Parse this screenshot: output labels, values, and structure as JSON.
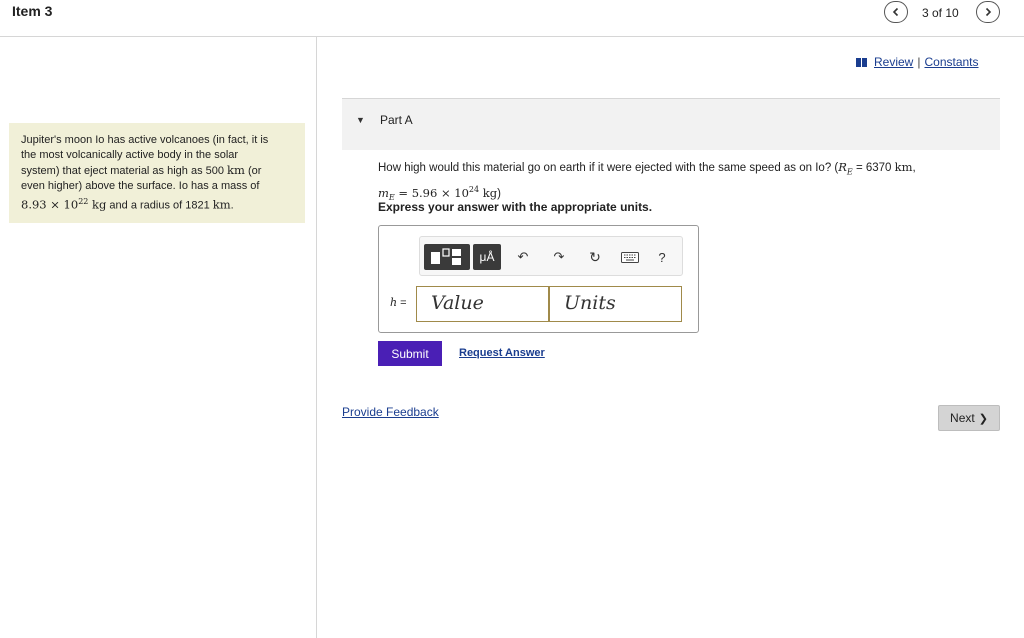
{
  "header": {
    "item_title": "Item 3",
    "pager": "3 of 10",
    "prev_icon": "chevron-left-icon",
    "next_icon": "chevron-right-icon"
  },
  "links": {
    "review": "Review",
    "separator": "|",
    "constants": "Constants",
    "book_icon": "book-icon"
  },
  "problem": {
    "line1": "Jupiter's moon Io has active volcanoes (in fact, it is",
    "line2": "the most volcanically active body in the solar",
    "line3a": "system) that eject material as high as 500 ",
    "line3b": "km",
    "line3c": " (or",
    "line4": "even higher) above the surface. Io has a mass of",
    "mass_base": "8.93 × 10",
    "mass_exp": "22",
    "mass_unit": " kg",
    "radius_text": " and a radius of 1821 ",
    "radius_unit": "km",
    "period": "."
  },
  "part": {
    "caret": "▼",
    "label": "Part A"
  },
  "question": {
    "text1": "How high would this material go on earth if it were ejected with the same speed as on Io? (",
    "re_symbol": "R",
    "re_sub": "E",
    "re_value": " = 6370 ",
    "re_unit": "km",
    "comma": ",",
    "me_symbol": "m",
    "me_sub": "E",
    "me_value": " = 5.96 × 10",
    "me_exp": "24",
    "me_unit": " kg",
    "close": ")",
    "instruction": "Express your answer with the appropriate units."
  },
  "answer": {
    "variable": "h",
    "equals": " =",
    "value_placeholder": "Value",
    "units_placeholder": "Units",
    "units_button": "μÅ",
    "undo": "↶",
    "redo": "↷",
    "reset": "↻",
    "help": "?"
  },
  "actions": {
    "submit": "Submit",
    "request_answer": "Request Answer",
    "provide_feedback": "Provide Feedback",
    "next": "Next",
    "next_arrow": "❯"
  }
}
